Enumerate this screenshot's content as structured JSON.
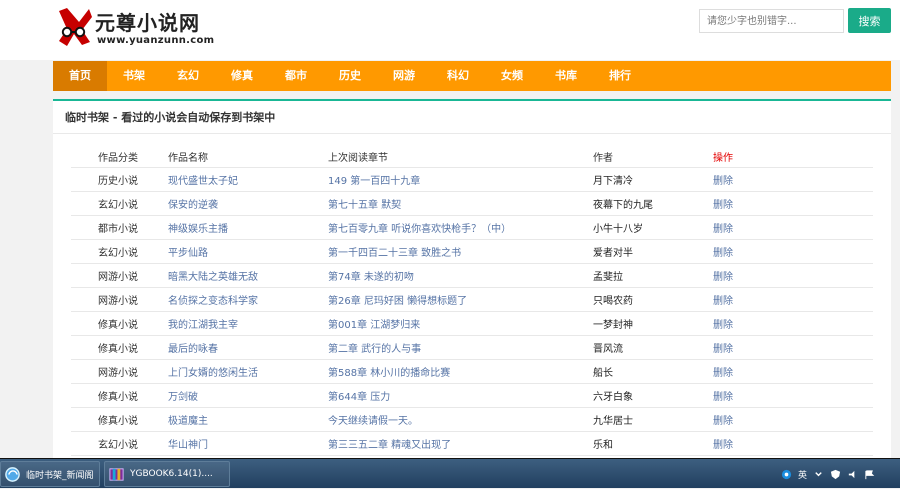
{
  "site": {
    "logo_name": "元尊小说网",
    "logo_url": "www.yuanzunn.com"
  },
  "search": {
    "placeholder": "请您少字也别错字...",
    "button": "搜索"
  },
  "nav": {
    "items": [
      "首页",
      "书架",
      "玄幻",
      "修真",
      "都市",
      "历史",
      "网游",
      "科幻",
      "女频",
      "书库",
      "排行"
    ]
  },
  "bookshelf": {
    "title": "临时书架 - 看过的小说会自动保存到书架中",
    "headers": [
      "作品分类",
      "作品名称",
      "上次阅读章节",
      "作者",
      "操作"
    ],
    "rows": [
      [
        "历史小说",
        "现代盛世太子妃",
        "149 第一百四十九章",
        "月下清冷",
        "删除"
      ],
      [
        "玄幻小说",
        "保安的逆袭",
        "第七十五章 默契",
        "夜幕下的九尾",
        "删除"
      ],
      [
        "都市小说",
        "神级娱乐主播",
        "第七百零九章 听说你喜欢快枪手？（中）",
        "小牛十八岁",
        "删除"
      ],
      [
        "玄幻小说",
        "平步仙路",
        "第一千四百二十三章 致胜之书",
        "爱者对半",
        "删除"
      ],
      [
        "网游小说",
        "暗黑大陆之英雄无敌",
        "第74章 未遂的初吻",
        "孟斐拉",
        "删除"
      ],
      [
        "网游小说",
        "名侦探之变态科学家",
        "第26章 尼玛好困 懒得想标题了",
        "只喝农药",
        "删除"
      ],
      [
        "修真小说",
        "我的江湖我主宰",
        "第001章 江湖梦归来",
        "一梦封神",
        "删除"
      ],
      [
        "修真小说",
        "最后的咏春",
        "第二章 武行的人与事",
        "晋风流",
        "删除"
      ],
      [
        "网游小说",
        "上门女婿的悠闲生活",
        "第588章 林小川的播命比赛",
        "船长",
        "删除"
      ],
      [
        "修真小说",
        "万剑破",
        "第644章 压力",
        "六牙白象",
        "删除"
      ],
      [
        "修真小说",
        "极道魔主",
        "今天继续请假一天。",
        "九华居士",
        "删除"
      ],
      [
        "玄幻小说",
        "华山神门",
        "第三三五二章 精魂又出现了",
        "乐和",
        "删除"
      ]
    ]
  },
  "taskbar": {
    "items": [
      {
        "label": "临时书架_新闻阁",
        "icon": "browser-icon"
      },
      {
        "label": "YGBOOK6.14(1)....",
        "icon": "archive-icon"
      }
    ],
    "tray_language": "英"
  },
  "colors": {
    "nav": "#ff9900",
    "nav_active": "#d97b00",
    "accent": "#19b795",
    "link": "#5573a5",
    "operation_header": "#e30000"
  }
}
